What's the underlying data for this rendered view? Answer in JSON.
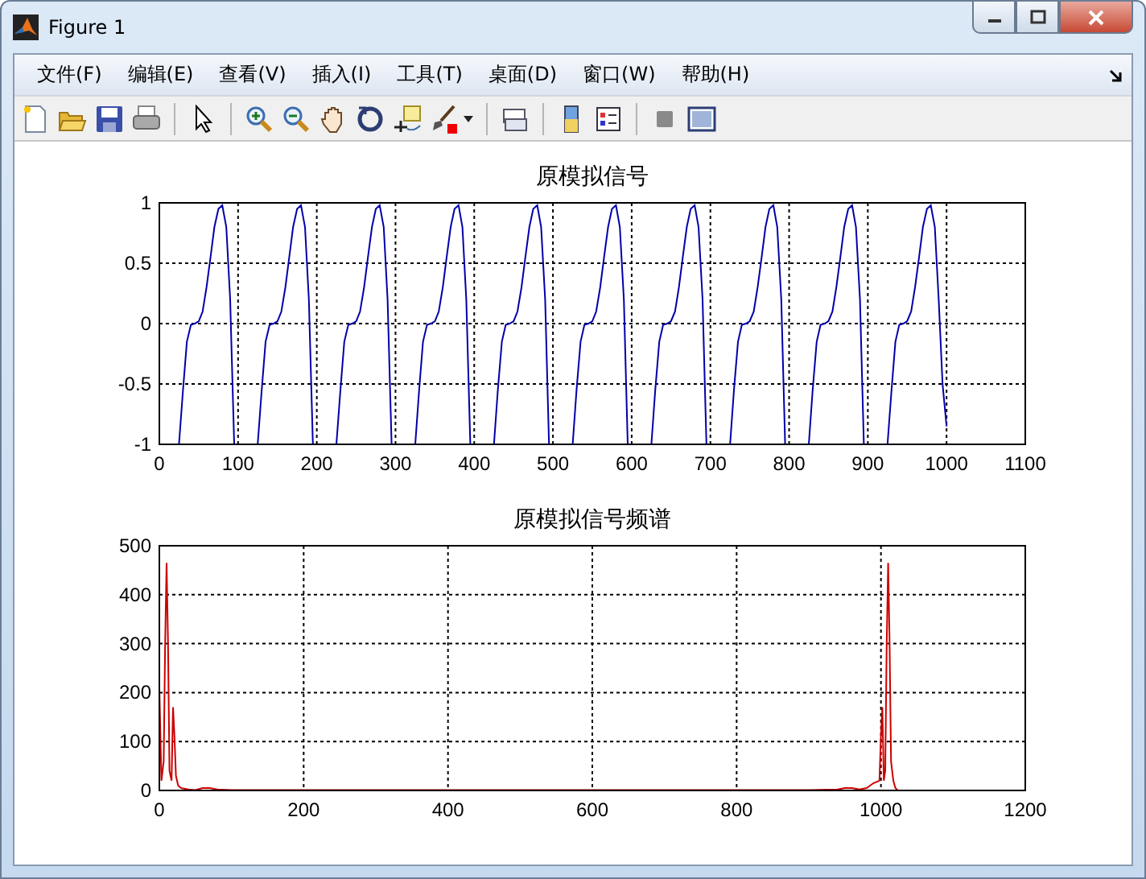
{
  "window": {
    "title": "Figure 1"
  },
  "menu": [
    "文件(F)",
    "编辑(E)",
    "查看(V)",
    "插入(I)",
    "工具(T)",
    "桌面(D)",
    "窗口(W)",
    "帮助(H)"
  ],
  "plots": [
    {
      "chart_data": {
        "type": "line",
        "title": "原模拟信号",
        "xlim": [
          0,
          1100
        ],
        "ylim": [
          -1,
          1
        ],
        "xticks": [
          0,
          100,
          200,
          300,
          400,
          500,
          600,
          700,
          800,
          900,
          1000,
          1100
        ],
        "yticks": [
          {
            "value": -1,
            "label": "-1"
          },
          {
            "value": -0.5,
            "label": "-0.5"
          },
          {
            "value": 0,
            "label": "0"
          },
          {
            "value": 0.5,
            "label": "0.5"
          },
          {
            "value": 1,
            "label": "1"
          }
        ],
        "grid": true,
        "x": [
          25,
          30,
          35,
          40,
          45,
          50,
          55,
          60,
          65,
          70,
          75,
          80,
          85,
          90,
          95,
          125,
          130,
          135,
          140,
          145,
          150,
          155,
          160,
          165,
          170,
          175,
          180,
          185,
          190,
          195,
          225,
          230,
          235,
          240,
          245,
          250,
          255,
          260,
          265,
          270,
          275,
          280,
          285,
          290,
          295,
          325,
          330,
          335,
          340,
          345,
          350,
          355,
          360,
          365,
          370,
          375,
          380,
          385,
          390,
          395,
          425,
          430,
          435,
          440,
          445,
          450,
          455,
          460,
          465,
          470,
          475,
          480,
          485,
          490,
          495,
          525,
          530,
          535,
          540,
          545,
          550,
          555,
          560,
          565,
          570,
          575,
          580,
          585,
          590,
          595,
          625,
          630,
          635,
          640,
          645,
          650,
          655,
          660,
          665,
          670,
          675,
          680,
          685,
          690,
          695,
          725,
          730,
          735,
          740,
          745,
          750,
          755,
          760,
          765,
          770,
          775,
          780,
          785,
          790,
          795,
          825,
          830,
          835,
          840,
          845,
          850,
          855,
          860,
          865,
          870,
          875,
          880,
          885,
          890,
          895,
          925,
          930,
          935,
          940,
          945,
          950,
          955,
          960,
          965,
          970,
          975,
          980,
          985,
          990,
          995,
          1000
        ],
        "series": [
          {
            "color": "#0000aa",
            "values": [
              -1,
              -0.55,
              -0.15,
              -0.01,
              0,
              0.02,
              0.1,
              0.3,
              0.55,
              0.8,
              0.95,
              0.98,
              0.8,
              0.2,
              -1,
              -1,
              -0.55,
              -0.15,
              -0.01,
              0,
              0.02,
              0.1,
              0.3,
              0.55,
              0.8,
              0.95,
              0.98,
              0.8,
              0.2,
              -1,
              -1,
              -0.55,
              -0.15,
              -0.01,
              0,
              0.02,
              0.1,
              0.3,
              0.55,
              0.8,
              0.95,
              0.98,
              0.8,
              0.2,
              -1,
              -1,
              -0.55,
              -0.15,
              -0.01,
              0,
              0.02,
              0.1,
              0.3,
              0.55,
              0.8,
              0.95,
              0.98,
              0.8,
              0.2,
              -1,
              -1,
              -0.55,
              -0.15,
              -0.01,
              0,
              0.02,
              0.1,
              0.3,
              0.55,
              0.8,
              0.95,
              0.98,
              0.8,
              0.2,
              -1,
              -1,
              -0.55,
              -0.15,
              -0.01,
              0,
              0.02,
              0.1,
              0.3,
              0.55,
              0.8,
              0.95,
              0.98,
              0.8,
              0.2,
              -1,
              -1,
              -0.55,
              -0.15,
              -0.01,
              0,
              0.02,
              0.1,
              0.3,
              0.55,
              0.8,
              0.95,
              0.98,
              0.8,
              0.2,
              -1,
              -1,
              -0.55,
              -0.15,
              -0.01,
              0,
              0.02,
              0.1,
              0.3,
              0.55,
              0.8,
              0.95,
              0.98,
              0.8,
              0.2,
              -1,
              -1,
              -0.55,
              -0.15,
              -0.01,
              0,
              0.02,
              0.1,
              0.3,
              0.55,
              0.8,
              0.95,
              0.98,
              0.8,
              0.2,
              -1,
              -1,
              -0.55,
              -0.15,
              -0.01,
              0,
              0.02,
              0.1,
              0.3,
              0.55,
              0.8,
              0.95,
              0.98,
              0.8,
              0.2,
              -0.5,
              -0.85
            ]
          }
        ]
      }
    },
    {
      "chart_data": {
        "type": "line",
        "title": "原模拟信号频谱",
        "xlim": [
          0,
          1200
        ],
        "ylim": [
          0,
          500
        ],
        "xticks": [
          0,
          200,
          400,
          600,
          800,
          1000,
          1200
        ],
        "yticks": [
          0,
          100,
          200,
          300,
          400,
          500
        ],
        "grid": true,
        "x": [
          0,
          3,
          6,
          8,
          10,
          12,
          14,
          17,
          19,
          21,
          23,
          26,
          30,
          40,
          50,
          60,
          70,
          80,
          100,
          200,
          300,
          400,
          500,
          600,
          700,
          800,
          900,
          940,
          950,
          960,
          970,
          980,
          990,
          998,
          1000,
          1002,
          1004,
          1006,
          1008,
          1010,
          1012,
          1014,
          1017,
          1020,
          1023
        ],
        "series": [
          {
            "color": "#cc0000",
            "values": [
              210,
              20,
              60,
              300,
              465,
              300,
              40,
              20,
              170,
              110,
              30,
              10,
              5,
              2,
              1,
              5,
              5,
              2,
              1,
              1,
              1,
              1,
              1,
              1,
              1,
              1,
              1,
              2,
              5,
              5,
              2,
              5,
              15,
              20,
              110,
              170,
              20,
              40,
              300,
              465,
              300,
              60,
              20,
              5,
              1
            ]
          }
        ]
      }
    }
  ]
}
